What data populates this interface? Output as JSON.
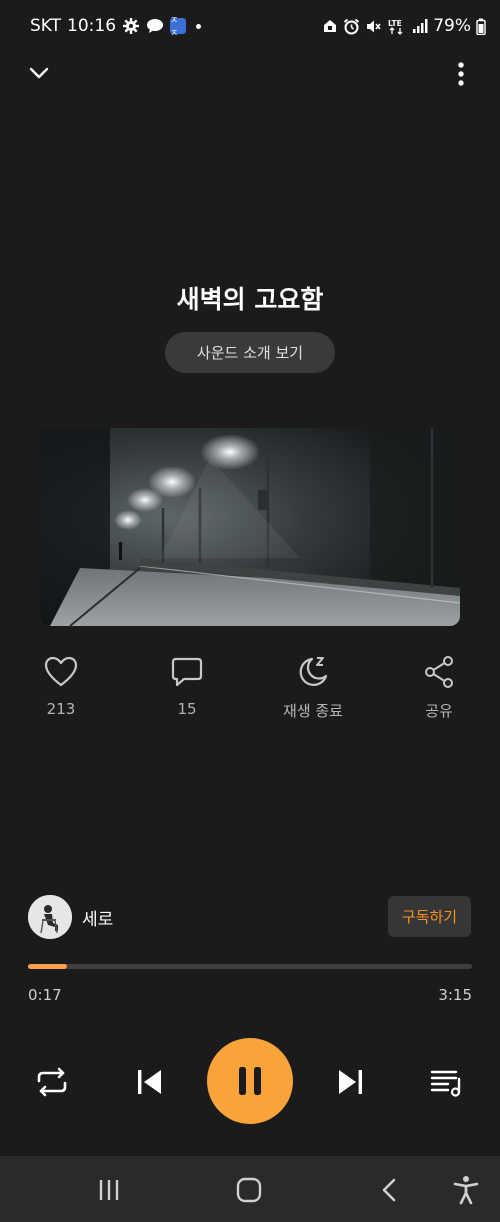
{
  "status": {
    "carrier": "SKT",
    "time": "10:16",
    "battery": "79%",
    "network": "LTE",
    "notification_badge": "ㅈㅈ",
    "icons": [
      "settings-gear-icon",
      "chat-bubble-icon",
      "app-badge-icon",
      "home-lock-icon",
      "alarm-icon",
      "mute-icon",
      "lte-icon",
      "signal-icon",
      "battery-icon"
    ]
  },
  "header": {
    "collapse_icon": "chevron-down-icon",
    "more_icon": "more-vertical-icon"
  },
  "track": {
    "title": "새벽의 고요함",
    "intro_button": "사운드 소개 보기",
    "artwork": "foggy-street-night-image"
  },
  "actions": [
    {
      "icon": "heart-icon",
      "label": "213"
    },
    {
      "icon": "comment-icon",
      "label": "15"
    },
    {
      "icon": "sleep-timer-icon",
      "label": "재생 종료"
    },
    {
      "icon": "share-icon",
      "label": "공유"
    }
  ],
  "artist": {
    "name": "세로",
    "subscribe": "구독하기"
  },
  "player": {
    "elapsed": "0:17",
    "duration": "3:15",
    "progress_fraction": 0.087,
    "accent": "#f8a43a"
  },
  "controls": [
    "repeat-icon",
    "skip-previous-icon",
    "pause-icon",
    "skip-next-icon",
    "playlist-icon"
  ],
  "navbar": [
    "recent-apps-icon",
    "home-icon",
    "back-icon",
    "accessibility-icon"
  ]
}
